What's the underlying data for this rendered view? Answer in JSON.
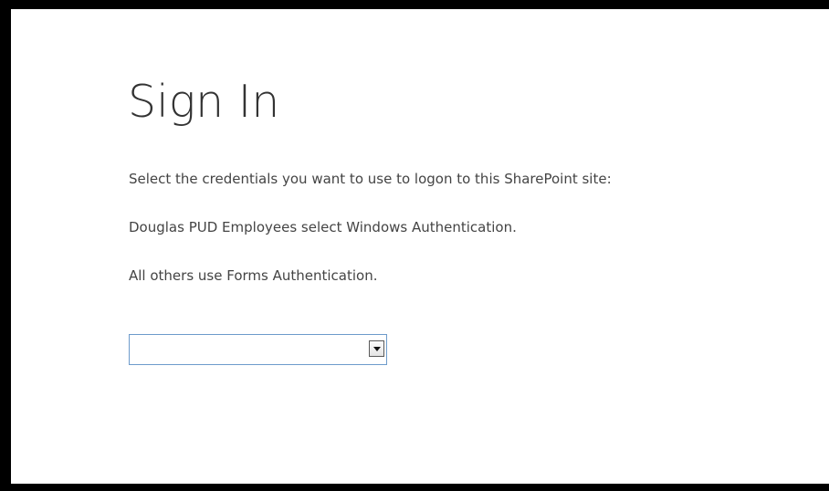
{
  "page": {
    "title": "Sign In",
    "instructions": [
      "Select the credentials you want to use to logon to this SharePoint site:",
      "Douglas PUD Employees select Windows Authentication.",
      "All others use Forms Authentication."
    ]
  },
  "credential_select": {
    "selected_value": "",
    "icon": "chevron-down-icon"
  },
  "colors": {
    "frame_border": "#000000",
    "background": "#ffffff",
    "title_text": "#333333",
    "body_text": "#444444",
    "select_border": "#6d9bcb"
  }
}
